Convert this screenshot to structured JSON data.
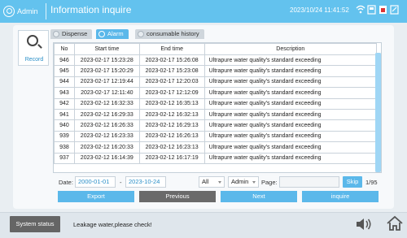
{
  "header": {
    "user": "Admin",
    "title": "Information inquire",
    "datetime": "2023/10/24 11:41:52",
    "icons": [
      "wifi-icon",
      "network-icon",
      "lock-icon",
      "usb-icon"
    ]
  },
  "sidebar": {
    "record_label": "Record"
  },
  "tabs": [
    {
      "label": "Dispense",
      "active": false
    },
    {
      "label": "Alarm",
      "active": true
    },
    {
      "label": "consumable history",
      "active": false
    }
  ],
  "table": {
    "headers": [
      "No",
      "Start time",
      "End time",
      "Description"
    ],
    "rows": [
      [
        "946",
        "2023-02-17 15:23:28",
        "2023-02-17 15:26:08",
        "Ultrapure water quality's standard exceeding"
      ],
      [
        "945",
        "2023-02-17 15:20:29",
        "2023-02-17 15:23:08",
        "Ultrapure water quality's standard exceeding"
      ],
      [
        "944",
        "2023-02-17 12:19:44",
        "2023-02-17 12:20:03",
        "Ultrapure water quality's standard exceeding"
      ],
      [
        "943",
        "2023-02-17 12:11:40",
        "2023-02-17 12:12:09",
        "Ultrapure water quality's standard exceeding"
      ],
      [
        "942",
        "2023-02-12 16:32:33",
        "2023-02-12 16:35:13",
        "Ultrapure water quality's standard exceeding"
      ],
      [
        "941",
        "2023-02-12 16:29:33",
        "2023-02-12 16:32:13",
        "Ultrapure water quality's standard exceeding"
      ],
      [
        "940",
        "2023-02-12 16:26:33",
        "2023-02-12 16:29:13",
        "Ultrapure water quality's standard exceeding"
      ],
      [
        "939",
        "2023-02-12 16:23:33",
        "2023-02-12 16:26:13",
        "Ultrapure water quality's standard exceeding"
      ],
      [
        "938",
        "2023-02-12 16:20:33",
        "2023-02-12 16:23:13",
        "Ultrapure water quality's standard exceeding"
      ],
      [
        "937",
        "2023-02-12 16:14:39",
        "2023-02-12 16:17:19",
        "Ultrapure water quality's standard exceeding"
      ]
    ]
  },
  "filters": {
    "date_label": "Date:",
    "date_from": "2000-01-01",
    "date_separator": "-",
    "date_to": "2023-10-24",
    "type_select": "All",
    "user_select": "Admin",
    "page_label": "Page:",
    "skip_label": "Skip",
    "page_count": "1/95"
  },
  "actions": {
    "export": "Export",
    "previous": "Previous",
    "next": "Next",
    "inquire": "inquire"
  },
  "footer": {
    "status_button": "System status",
    "alert_text": "Leakage water,please check!"
  },
  "colors": {
    "header_bg": "#63c2ee",
    "accent": "#5bb8ea",
    "disabled_button": "#6a6a6a",
    "status_button": "#656565"
  }
}
